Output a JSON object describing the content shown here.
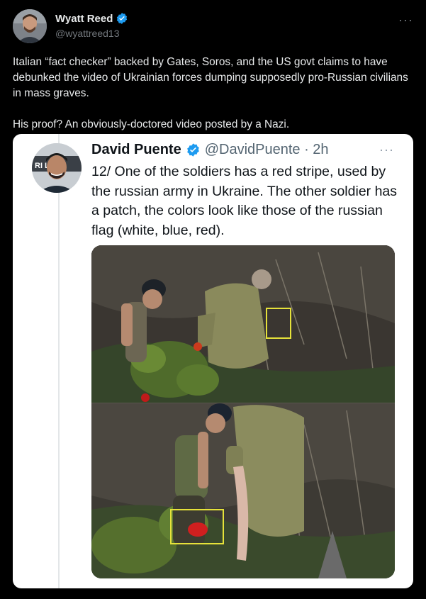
{
  "post": {
    "author": {
      "name": "Wyatt Reed",
      "handle": "@wyattreed13",
      "verified": true
    },
    "more_icon": "more-horizontal-icon",
    "text_line1": "Italian “fact checker” backed by Gates, Soros, and the US govt claims to have debunked the video of Ukrainian forces dumping supposedly pro-Russian civilians in mass graves.",
    "text_line2": "His proof? An obviously-doctored video posted by a Nazi."
  },
  "quote": {
    "author": {
      "name": "David Puente",
      "handle_time": "@DavidPuente · 2h",
      "verified": true
    },
    "avatar_banner": "RI          LE",
    "text": "12/ One of the soldiers has a red stripe, used by the russian army in Ukraine. The other soldier has a patch, the colors look like those of the russian flag (white, blue, red).",
    "media": {
      "panels": 2,
      "highlight_color": "#e6e23a"
    }
  },
  "colors": {
    "background": "#000000",
    "text_primary": "#e7e9ea",
    "text_secondary": "#71767b",
    "verified_blue": "#1d9bf0",
    "card_background": "#ffffff"
  }
}
